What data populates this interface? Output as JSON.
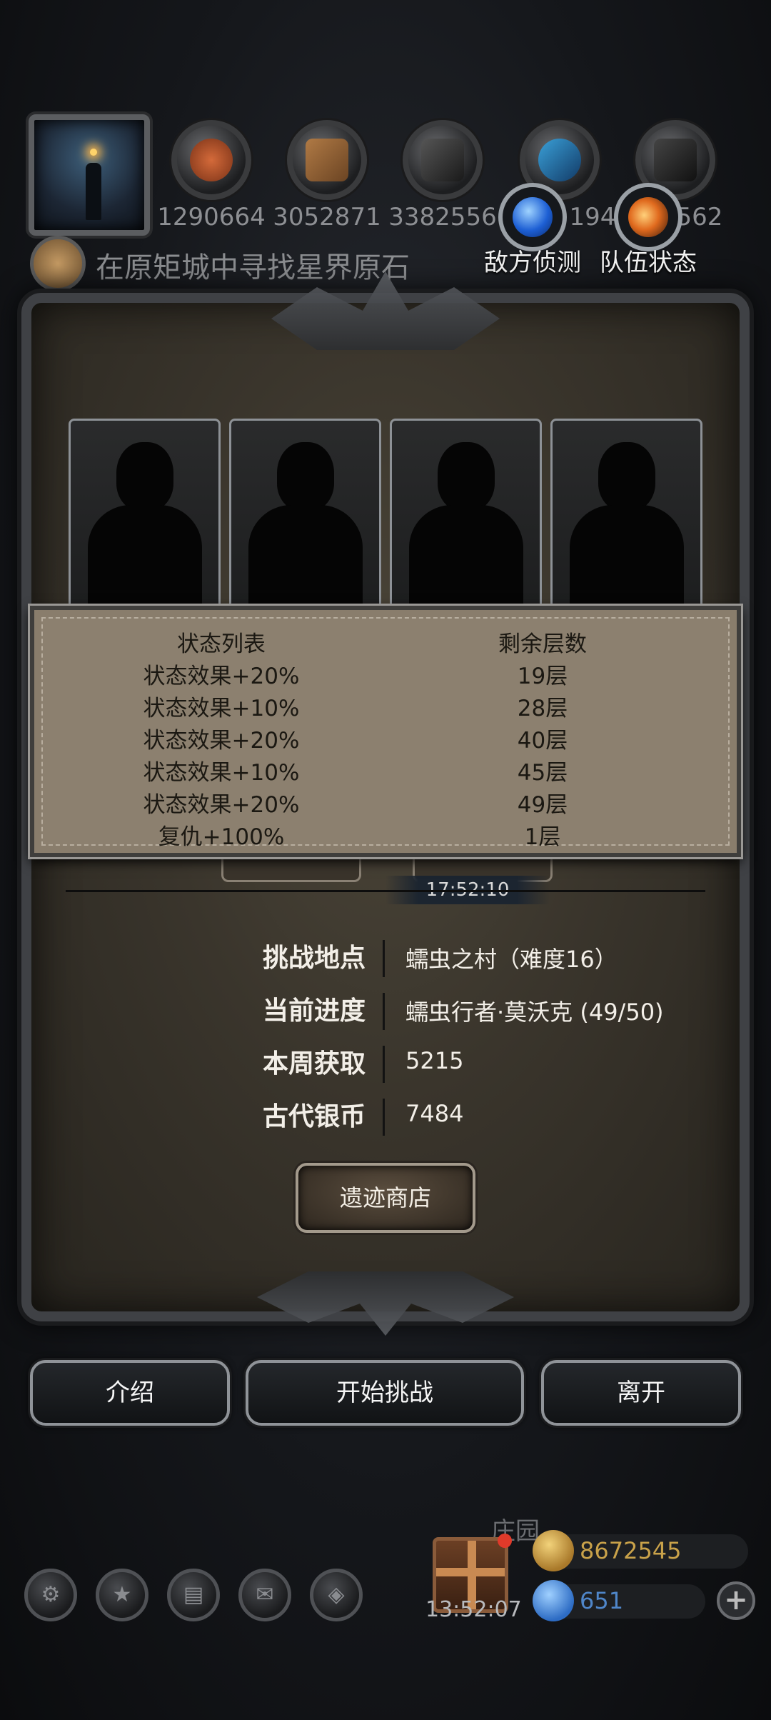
{
  "hud": {
    "resources": [
      {
        "icon": "meat-icon",
        "value": "1290664"
      },
      {
        "icon": "wood-icon",
        "value": "3052871"
      },
      {
        "icon": "iron-icon",
        "value": "3382556"
      },
      {
        "icon": "crystal-icon",
        "value": "194"
      },
      {
        "icon": "ore-icon",
        "value": "562"
      }
    ],
    "enemy_scout_label": "敌方侦测",
    "team_status_label": "队伍状态",
    "quest_text": "在原矩城中寻找星界原石"
  },
  "status_panel": {
    "col1_header": "状态列表",
    "col2_header": "剩余层数",
    "rows": [
      {
        "effect": "状态效果+20%",
        "layers": "19层"
      },
      {
        "effect": "状态效果+10%",
        "layers": "28层"
      },
      {
        "effect": "状态效果+20%",
        "layers": "40层"
      },
      {
        "effect": "状态效果+10%",
        "layers": "45层"
      },
      {
        "effect": "状态效果+20%",
        "layers": "49层"
      },
      {
        "effect": "复仇+100%",
        "layers": "1层"
      }
    ]
  },
  "timer": "17:52:10",
  "info": {
    "location_label": "挑战地点",
    "location_value": "蠕虫之村（难度16）",
    "progress_label": "当前进度",
    "progress_value": "蠕虫行者·莫沃克 (49/50)",
    "weekly_label": "本周获取",
    "weekly_value": "5215",
    "coin_label": "古代银币",
    "coin_value": "7484"
  },
  "shop_button": "遗迹商店",
  "actions": {
    "intro": "介绍",
    "start": "开始挑战",
    "leave": "离开"
  },
  "bottom": {
    "manor_label": "庄园",
    "gift_timer": "13:52:07",
    "gold_amount": "8672545",
    "gem_amount": "651"
  },
  "colors": {
    "gold": "#c9a24a",
    "gem": "#4f86c9",
    "panel": "#8c806f"
  }
}
